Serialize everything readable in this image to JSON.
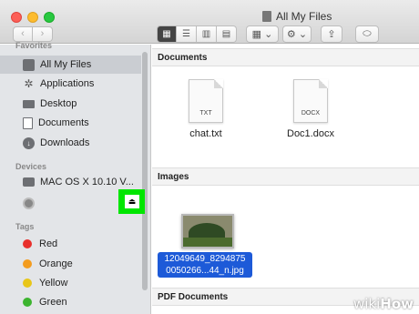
{
  "window": {
    "title": "All My Files"
  },
  "nav": {
    "back": "‹",
    "forward": "›"
  },
  "toolbar": {
    "views": [
      "▦",
      "☰",
      "▥",
      "▤"
    ],
    "arrange": "▦ ⌄",
    "action": "⚙ ⌄",
    "share": "⇪",
    "tags": "⬭"
  },
  "sidebar": {
    "favorites_header": "Favorites",
    "favorites": [
      {
        "label": "All My Files",
        "icon": "all-files-icon",
        "selected": true
      },
      {
        "label": "Applications",
        "icon": "applications-icon"
      },
      {
        "label": "Desktop",
        "icon": "desktop-icon"
      },
      {
        "label": "Documents",
        "icon": "documents-icon"
      },
      {
        "label": "Downloads",
        "icon": "downloads-icon"
      }
    ],
    "devices_header": "Devices",
    "devices": [
      {
        "label": "MAC OS X 10.10 V...",
        "icon": "hard-disk-icon"
      },
      {
        "label": "",
        "icon": "cd-icon"
      }
    ],
    "eject": "⏏",
    "tags_header": "Tags",
    "tags": [
      {
        "label": "Red",
        "color": "#e8302c"
      },
      {
        "label": "Orange",
        "color": "#f39c1f"
      },
      {
        "label": "Yellow",
        "color": "#e8c619"
      },
      {
        "label": "Green",
        "color": "#3cb42f"
      }
    ]
  },
  "main": {
    "sections": [
      {
        "title": "Documents"
      },
      {
        "title": "Images"
      },
      {
        "title": "PDF Documents"
      }
    ],
    "documents": [
      {
        "name": "chat.txt",
        "ext": "TXT"
      },
      {
        "name": "Doc1.docx",
        "ext": "DOCX"
      }
    ],
    "image": {
      "name_line1": "12049649_8294875",
      "name_line2": "0050266...44_n.jpg"
    }
  },
  "watermark": {
    "wiki": "wiki",
    "how": "How"
  }
}
